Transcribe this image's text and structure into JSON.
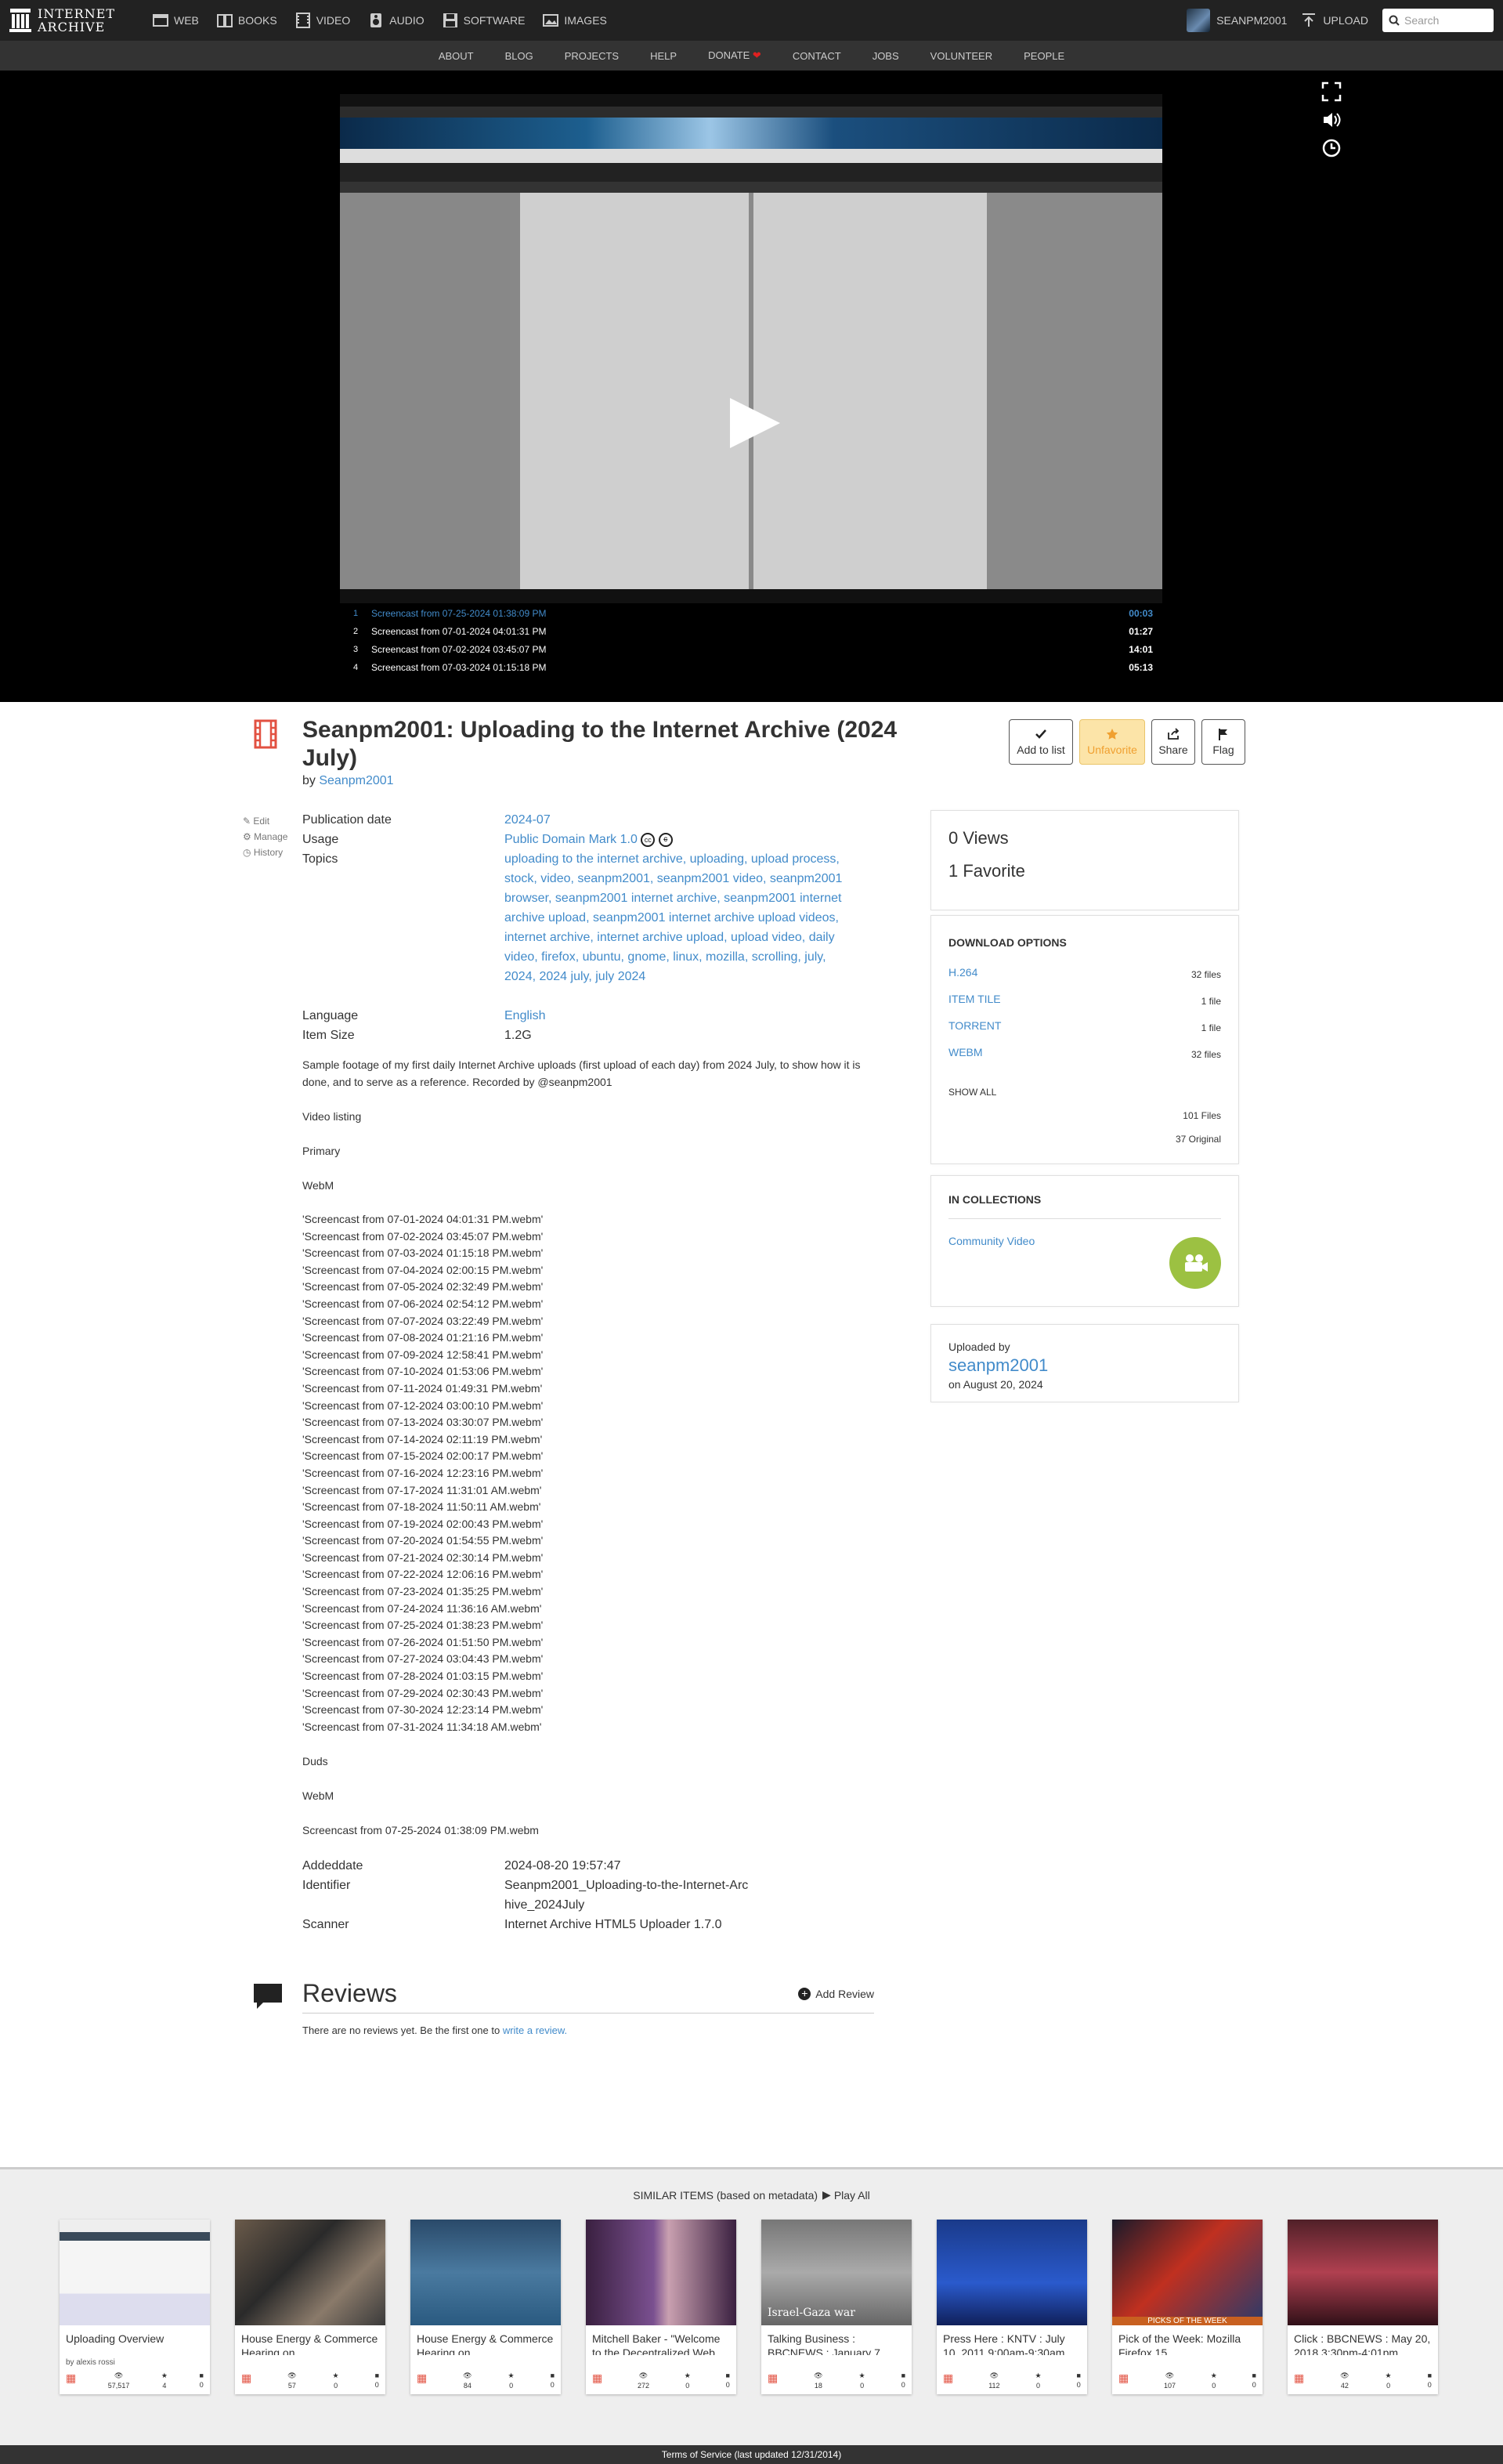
{
  "header": {
    "logo_line1": "INTERNET",
    "logo_line2": "ARCHIVE",
    "media": [
      {
        "label": "WEB",
        "icon": "web-icon"
      },
      {
        "label": "BOOKS",
        "icon": "books-icon"
      },
      {
        "label": "VIDEO",
        "icon": "video-icon"
      },
      {
        "label": "AUDIO",
        "icon": "audio-icon"
      },
      {
        "label": "SOFTWARE",
        "icon": "software-icon"
      },
      {
        "label": "IMAGES",
        "icon": "images-icon"
      }
    ],
    "username": "SEANPM2001",
    "upload_label": "UPLOAD",
    "search_placeholder": "Search"
  },
  "subnav": [
    "ABOUT",
    "BLOG",
    "PROJECTS",
    "HELP",
    "DONATE",
    "CONTACT",
    "JOBS",
    "VOLUNTEER",
    "PEOPLE"
  ],
  "player": {
    "playlist": [
      {
        "num": "1",
        "title": "Screencast from 07-25-2024 01:38:09 PM",
        "duration": "00:03"
      },
      {
        "num": "2",
        "title": "Screencast from 07-01-2024 04:01:31 PM",
        "duration": "01:27"
      },
      {
        "num": "3",
        "title": "Screencast from 07-02-2024 03:45:07 PM",
        "duration": "14:01"
      },
      {
        "num": "4",
        "title": "Screencast from 07-03-2024 01:15:18 PM",
        "duration": "05:13"
      }
    ]
  },
  "item": {
    "title": "Seanpm2001: Uploading to the Internet Archive (2024 July)",
    "by_prefix": "by",
    "creator": "Seanpm2001",
    "actions": [
      "Add to list",
      "Unfavorite",
      "Share",
      "Flag"
    ],
    "edit_links": [
      "Edit",
      "Manage",
      "History"
    ],
    "publication_date_label": "Publication date",
    "publication_date": "2024-07",
    "usage_label": "Usage",
    "usage": "Public Domain Mark 1.0",
    "topics_label": "Topics",
    "topics": "uploading to the internet archive, uploading, upload process, stock, video, seanpm2001, seanpm2001 video, seanpm2001 browser, seanpm2001 internet archive, seanpm2001 internet archive upload, seanpm2001 internet archive upload videos, internet archive, internet archive upload, upload video, daily video, firefox, ubuntu, gnome, linux, mozilla, scrolling, july, 2024, 2024 july, july 2024",
    "language_label": "Language",
    "language": "English",
    "size_label": "Item Size",
    "size": "1.2G",
    "description": "Sample footage of my first daily Internet Archive uploads (first upload of each day) from 2024 July, to show how it is done, and to serve as a reference. Recorded by @seanpm2001",
    "video_listing": "Video listing",
    "primary": "Primary",
    "webm": "WebM",
    "files": [
      "'Screencast from 07-01-2024 04:01:31 PM.webm'",
      "'Screencast from 07-02-2024 03:45:07 PM.webm'",
      "'Screencast from 07-03-2024 01:15:18 PM.webm'",
      "'Screencast from 07-04-2024 02:00:15 PM.webm'",
      "'Screencast from 07-05-2024 02:32:49 PM.webm'",
      "'Screencast from 07-06-2024 02:54:12 PM.webm'",
      "'Screencast from 07-07-2024 03:22:49 PM.webm'",
      "'Screencast from 07-08-2024 01:21:16 PM.webm'",
      "'Screencast from 07-09-2024 12:58:41 PM.webm'",
      "'Screencast from 07-10-2024 01:53:06 PM.webm'",
      "'Screencast from 07-11-2024 01:49:31 PM.webm'",
      "'Screencast from 07-12-2024 03:00:10 PM.webm'",
      "'Screencast from 07-13-2024 03:30:07 PM.webm'",
      "'Screencast from 07-14-2024 02:11:19 PM.webm'",
      "'Screencast from 07-15-2024 02:00:17 PM.webm'",
      "'Screencast from 07-16-2024 12:23:16 PM.webm'",
      "'Screencast from 07-17-2024 11:31:01 AM.webm'",
      "'Screencast from 07-18-2024 11:50:11 AM.webm'",
      "'Screencast from 07-19-2024 02:00:43 PM.webm'",
      "'Screencast from 07-20-2024 01:54:55 PM.webm'",
      "'Screencast from 07-21-2024 02:30:14 PM.webm'",
      "'Screencast from 07-22-2024 12:06:16 PM.webm'",
      "'Screencast from 07-23-2024 01:35:25 PM.webm'",
      "'Screencast from 07-24-2024 11:36:16 AM.webm'",
      "'Screencast from 07-25-2024 01:38:23 PM.webm'",
      "'Screencast from 07-26-2024 01:51:50 PM.webm'",
      "'Screencast from 07-27-2024 03:04:43 PM.webm'",
      "'Screencast from 07-28-2024 01:03:15 PM.webm'",
      "'Screencast from 07-29-2024 02:30:43 PM.webm'",
      "'Screencast from 07-30-2024 12:23:14 PM.webm'",
      "'Screencast from 07-31-2024 11:34:18 AM.webm'"
    ],
    "duds": "Duds",
    "duds_webm": "WebM",
    "dud_file": "Screencast from 07-25-2024 01:38:09 PM.webm",
    "addeddate_label": "Addeddate",
    "addeddate": "2024-08-20 19:57:47",
    "identifier_label": "Identifier",
    "identifier": "Seanpm2001_Uploading-to-the-Internet-Archive_2024July",
    "scanner_label": "Scanner",
    "scanner": "Internet Archive HTML5 Uploader 1.7.0"
  },
  "sidebar": {
    "views": "0 Views",
    "favorites": "1 Favorite",
    "download_title": "DOWNLOAD OPTIONS",
    "downloads": [
      {
        "label": "H.264",
        "count": "32 files"
      },
      {
        "label": "ITEM TILE",
        "count": "1 file"
      },
      {
        "label": "TORRENT",
        "count": "1 file"
      },
      {
        "label": "WEBM",
        "count": "32 files"
      }
    ],
    "show_all": "SHOW ALL",
    "total_files": "101 Files",
    "original_files": "37 Original",
    "collections_title": "IN COLLECTIONS",
    "collection": "Community Video",
    "uploaded_by_label": "Uploaded by",
    "uploader": "seanpm2001",
    "upload_date": "on August 20, 2024"
  },
  "reviews": {
    "title": "Reviews",
    "add_label": "Add Review",
    "empty_prefix": "There are no reviews yet. Be the first one to",
    "write_link": "write a review.",
    "empty_suffix": ""
  },
  "similar": {
    "heading": "SIMILAR ITEMS (based on metadata)",
    "play_all": "Play All",
    "items": [
      {
        "title": "Uploading Overview",
        "by": "by alexis rossi",
        "views": "57,517",
        "favs": "4",
        "reviews": "0"
      },
      {
        "title": "House Energy & Commerce Hearing on",
        "by": "",
        "views": "57",
        "favs": "0",
        "reviews": "0"
      },
      {
        "title": "House Energy & Commerce Hearing on",
        "by": "",
        "views": "84",
        "favs": "0",
        "reviews": "0"
      },
      {
        "title": "Mitchell Baker - \"Welcome to the Decentralized Web",
        "by": "",
        "views": "272",
        "favs": "0",
        "reviews": "0"
      },
      {
        "title": "Talking Business : BBCNEWS : January 7,",
        "by": "",
        "views": "18",
        "favs": "0",
        "reviews": "0"
      },
      {
        "title": "Press Here : KNTV : July 10, 2011 9:00am-9:30am",
        "by": "",
        "views": "112",
        "favs": "0",
        "reviews": "0"
      },
      {
        "title": "Pick of the Week: Mozilla Firefox 15",
        "by": "",
        "views": "107",
        "favs": "0",
        "reviews": "0"
      },
      {
        "title": "Click : BBCNEWS : May 20, 2018 3:30pm-4:01pm",
        "by": "",
        "views": "42",
        "favs": "0",
        "reviews": "0"
      }
    ],
    "thumb4_caption": "Israel-Gaza war",
    "thumb6_caption": "PICKS OF THE WEEK"
  },
  "footer": "Terms of Service (last updated 12/31/2014)",
  "colors": {
    "link": "#428bca",
    "favorite": "#f0a030",
    "collection_badge": "#9cc142",
    "item_icon": "#e25141"
  }
}
